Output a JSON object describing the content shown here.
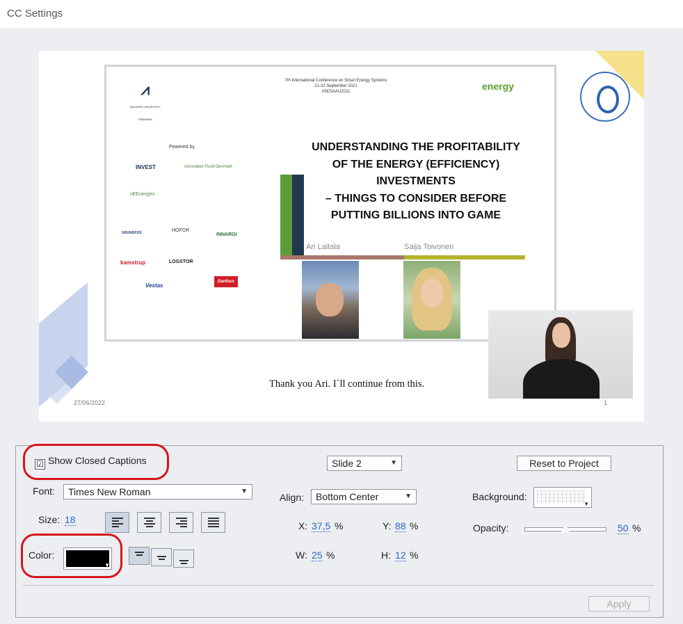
{
  "window": {
    "title": "CC Settings"
  },
  "preview": {
    "conference": [
      "7th International Conference on Smart Energy Systems",
      "21-22 September 2021",
      "#SESAAU2021"
    ],
    "university_logo_text": "AALBORG UNIVERSITY DENMARK",
    "energy_logo": "energy",
    "powered_by": "Powered by",
    "sponsors": [
      "INVEST",
      "Innovation Fund Denmark",
      "sEEnergies",
      "GRUNDFOS",
      "HOFOR",
      "INNARGI",
      "kamstrup",
      "LOGSTOR",
      "Vestas",
      "Danfoss"
    ],
    "title_lines": [
      "UNDERSTANDING THE PROFITABILITY",
      "OF THE ENERGY (EFFICIENCY)",
      "INVESTMENTS",
      "– THINGS TO CONSIDER BEFORE",
      "PUTTING BILLIONS INTO GAME"
    ],
    "presenter1": "Ari Laitala",
    "presenter2": "Saija Toivonen",
    "caption": "Thank you Ari. I´ll continue from this.",
    "date": "27/06/2022",
    "page_number": "1"
  },
  "settings": {
    "show_cc_label": "Show Closed Captions",
    "show_cc_checked": "☑",
    "slide_select": "Slide 2",
    "reset_label": "Reset to Project",
    "font_label": "Font:",
    "font_value": "Times New Roman",
    "size_label": "Size:",
    "size_value": "18",
    "align_label": "Align:",
    "align_value": "Bottom Center",
    "background_label": "Background:",
    "opacity_label": "Opacity:",
    "opacity_value": "50",
    "opacity_unit": "%",
    "color_label": "Color:",
    "color_value": "#000000",
    "x_label": "X:",
    "x_value": "37,5",
    "y_label": "Y:",
    "y_value": "88",
    "w_label": "W:",
    "w_value": "25",
    "h_label": "H:",
    "h_value": "12",
    "percent": "%",
    "apply_label": "Apply"
  },
  "colors": {
    "link": "#2a66c8",
    "annotation": "#d8141a"
  }
}
